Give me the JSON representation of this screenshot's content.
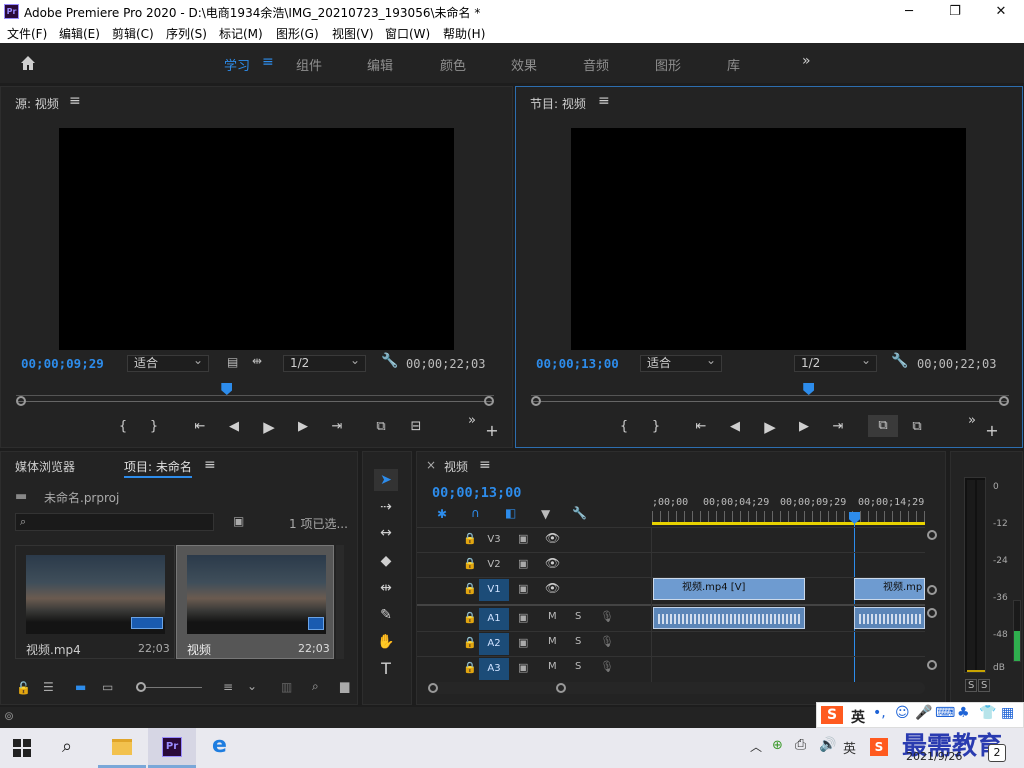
{
  "window": {
    "title": "Adobe Premiere Pro 2020 - D:\\电商1934余浩\\IMG_20210723_193056\\未命名 *",
    "logo": "Pr"
  },
  "menu": [
    "文件(F)",
    "编辑(E)",
    "剪辑(C)",
    "序列(S)",
    "标记(M)",
    "图形(G)",
    "视图(V)",
    "窗口(W)",
    "帮助(H)"
  ],
  "workspaces": [
    "学习",
    "组件",
    "编辑",
    "颜色",
    "效果",
    "音频",
    "图形",
    "库"
  ],
  "source": {
    "title": "源: 视频",
    "timecode_in": "00;00;09;29",
    "fit": "适合",
    "res": "1/2",
    "timecode_dur": "00;00;22;03",
    "playhead": 0.44
  },
  "program": {
    "title": "节目: 视频",
    "timecode_in": "00;00;13;00",
    "fit": "适合",
    "res": "1/2",
    "timecode_dur": "00;00;22;03",
    "playhead": 0.58
  },
  "project": {
    "tabs": [
      "媒体浏览器",
      "项目: 未命名"
    ],
    "file": "未命名.prproj",
    "count": "1 项已选...",
    "items": [
      {
        "name": "视频.mp4",
        "dur": "22;03"
      },
      {
        "name": "视频",
        "dur": "22;03"
      }
    ]
  },
  "timeline": {
    "tab": "视频",
    "timecode": "00;00;13;00",
    "ruler": [
      ";00;00",
      "00;00;04;29",
      "00;00;09;29",
      "00;00;14;29"
    ],
    "video_tracks": [
      "V3",
      "V2",
      "V1"
    ],
    "audio_tracks": [
      "A1",
      "A2",
      "A3"
    ],
    "clip_v1": "视频.mp4 [V]",
    "clip_v1b": "视频.mp",
    "m_label": "M",
    "s_label": "S"
  },
  "meter": {
    "scale": [
      "0",
      "-12",
      "-24",
      "-36",
      "-48",
      "dB"
    ],
    "solo": [
      "S",
      "S"
    ]
  },
  "taskbar": {
    "ime": "英",
    "tray_ime": "英",
    "watermark": "最需教育",
    "date": "2021/9/26",
    "badge": "2"
  }
}
